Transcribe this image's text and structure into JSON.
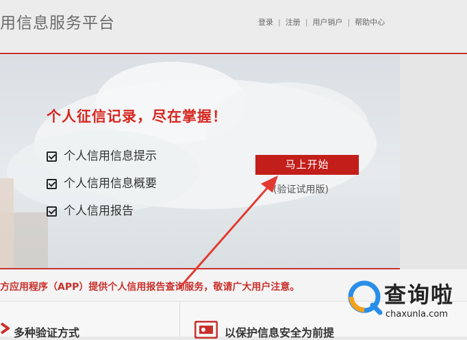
{
  "header": {
    "site_title": "用信息服务平台",
    "nav": [
      "登录",
      "注册",
      "用户销户",
      "帮助中心"
    ]
  },
  "banner": {
    "headline": "个人征信记录，尽在掌握！",
    "features": [
      "个人信用信息提示",
      "个人信用信息概要",
      "个人信用报告"
    ],
    "start_button": "马上开始",
    "trial_text": "(验证试用版)"
  },
  "notice": {
    "text": "方应用程序（APP）提供个人信用报告查询服务，敬请广大用户注意。"
  },
  "lower": {
    "features": [
      "多种验证方式",
      "以保护信息安全为前提"
    ]
  },
  "watermark": {
    "name": "查询啦",
    "url": "chaxunla.com"
  },
  "colors": {
    "accent": "#c9302c",
    "button": "#c21e1a"
  }
}
